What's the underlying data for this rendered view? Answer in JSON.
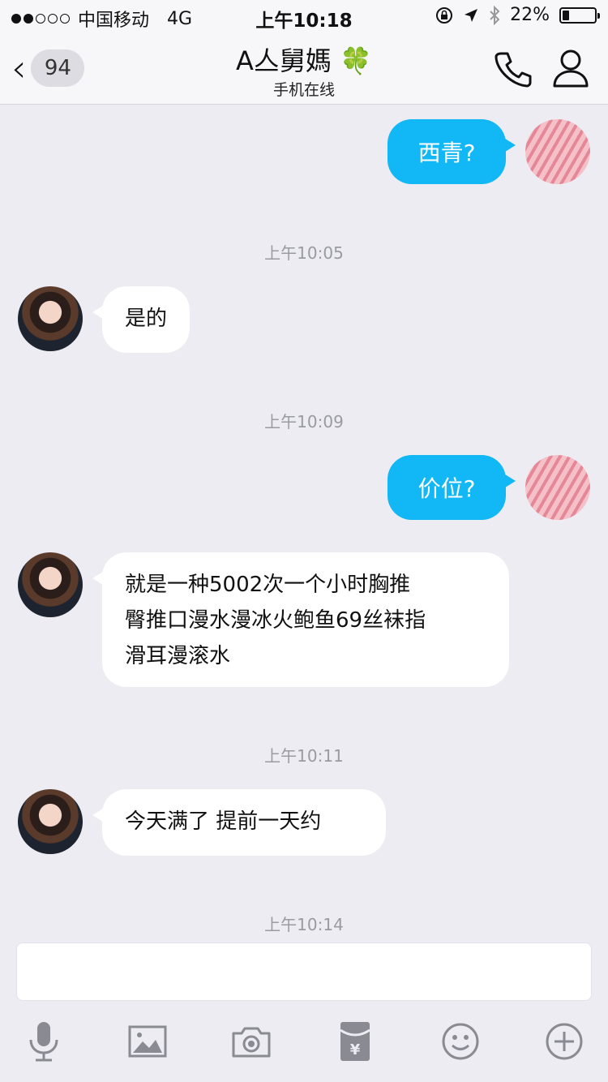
{
  "status_bar": {
    "carrier": "中国移动",
    "network": "4G",
    "time": "上午10:18",
    "battery_percent": "22%",
    "battery_level": 0.22,
    "signal_bars": 2
  },
  "nav": {
    "back_count": "94",
    "title": "A亼舅媽",
    "title_emoji": "🍀",
    "subtitle": "手机在线"
  },
  "messages": {
    "m1": "西青?",
    "t1": "上午10:05",
    "m2": "是的",
    "t2": "上午10:09",
    "m3": "价位?",
    "m4_line1": "就是一种5002次一个小时胸推",
    "m4_line2": "臀推口漫水漫冰火鲍鱼69丝袜指",
    "m4_line3": "滑耳漫滚水",
    "t3": "上午10:11",
    "m5": "今天满了 提前一天约",
    "t4": "上午10:14"
  },
  "input": {
    "placeholder": ""
  },
  "toolbar": {
    "icons": [
      "microphone-icon",
      "image-icon",
      "camera-icon",
      "red-packet-icon",
      "emoji-icon",
      "plus-icon"
    ]
  },
  "colors": {
    "outgoing_bubble": "#12b7f5",
    "incoming_bubble": "#ffffff",
    "background": "#ececf2",
    "icon_gray": "#8a8a92"
  }
}
